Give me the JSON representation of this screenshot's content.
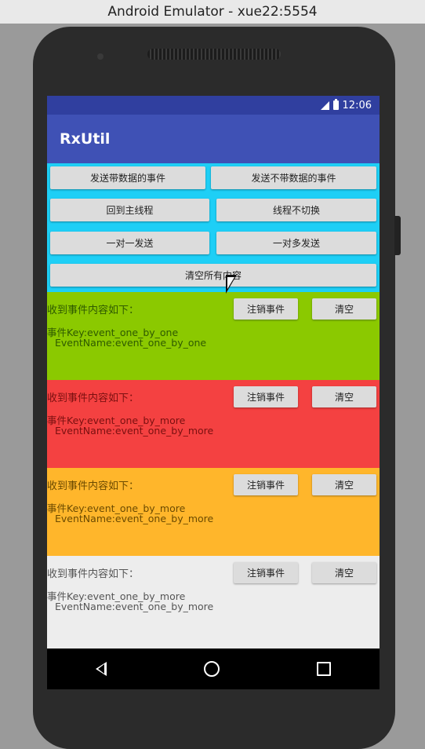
{
  "window": {
    "title": "Android Emulator - xue22:5554"
  },
  "statusbar": {
    "time": "12:06"
  },
  "appbar": {
    "title": "RxUtil"
  },
  "buttons": {
    "send_with_data": "发送带数据的事件",
    "send_without_data": "发送不带数据的事件",
    "back_to_main": "回到主线程",
    "no_thread_switch": "线程不切换",
    "one_to_one": "一对一发送",
    "one_to_many": "一对多发送",
    "clear_all": "清空所有内容"
  },
  "panels": [
    {
      "heading": "收到事件内容如下：",
      "key_line": "事件Key:event_one_by_one",
      "name_line": "EventName:event_one_by_one",
      "unregister": "注销事件",
      "clear": "清空",
      "bg": "#8bc900",
      "text_color": "#2f5a00"
    },
    {
      "heading": "收到事件内容如下：",
      "key_line": "事件Key:event_one_by_more",
      "name_line": "EventName:event_one_by_more",
      "unregister": "注销事件",
      "clear": "清空",
      "bg": "#f44141",
      "text_color": "#7a1010"
    },
    {
      "heading": "收到事件内容如下：",
      "key_line": "事件Key:event_one_by_more",
      "name_line": "EventName:event_one_by_more",
      "unregister": "注销事件",
      "clear": "清空",
      "bg": "#ffb62b",
      "text_color": "#6b4a00"
    },
    {
      "heading": "收到事件内容如下：",
      "key_line": "事件Key:event_one_by_more",
      "name_line": "EventName:event_one_by_more",
      "unregister": "注销事件",
      "clear": "清空",
      "bg": "#ededed",
      "text_color": "#555555"
    }
  ],
  "icons": {
    "signal": "signal-icon",
    "battery": "battery-icon",
    "back": "back-icon",
    "home": "home-icon",
    "recent": "recent-apps-icon",
    "cursor": "mouse-cursor-icon"
  }
}
